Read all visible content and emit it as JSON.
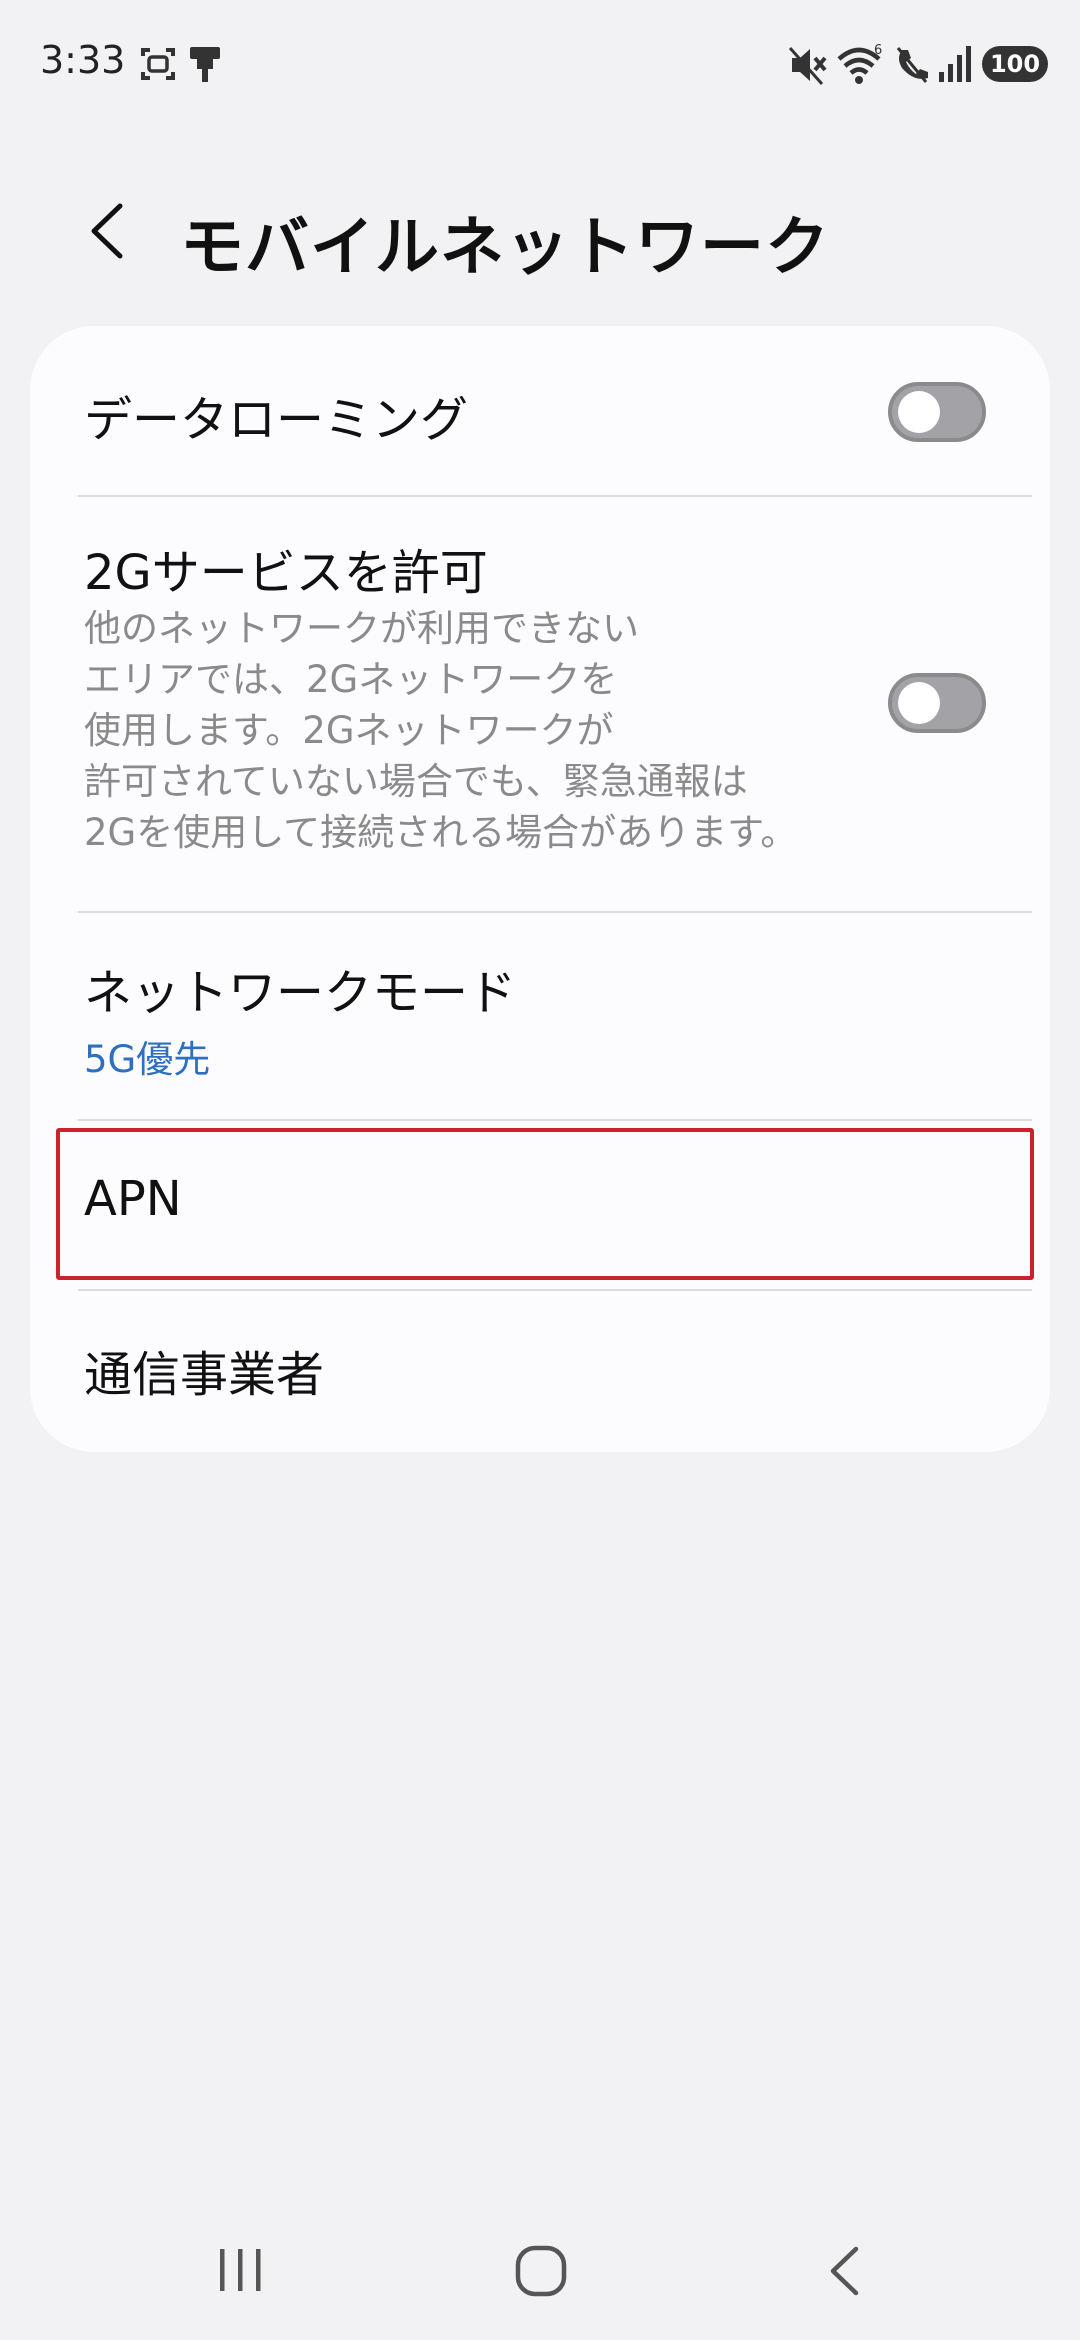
{
  "status_bar": {
    "time": "3:33",
    "battery": "100",
    "icons": [
      "screenshot-icon",
      "usb-icon",
      "mute-icon",
      "wifi-icon",
      "call-off-icon",
      "signal-icon",
      "battery-icon"
    ]
  },
  "header": {
    "title": "モバイルネットワーク",
    "back_icon": "back-chevron-icon"
  },
  "settings": {
    "data_roaming": {
      "title": "データローミング",
      "enabled": false
    },
    "allow_2g": {
      "title": "2Gサービスを許可",
      "description_lines": [
        "他のネットワークが利用できない",
        "エリアでは、2Gネットワークを",
        "使用します。2Gネットワークが",
        "許可されていない場合でも、緊急通報は",
        "2Gを使用して接続される場合があります。"
      ],
      "enabled": false
    },
    "network_mode": {
      "title": "ネットワークモード",
      "value": "5G優先"
    },
    "apn": {
      "title": "APN"
    },
    "carrier": {
      "title": "通信事業者"
    }
  },
  "nav_bar": {
    "icons": [
      "recents-icon",
      "home-icon",
      "back-icon"
    ]
  },
  "colors": {
    "background": "#f2f2f4",
    "card": "#fcfcff",
    "accent": "#2f6fc0",
    "highlight": "#c9232d",
    "toggle_off": "#a3a3a7"
  }
}
